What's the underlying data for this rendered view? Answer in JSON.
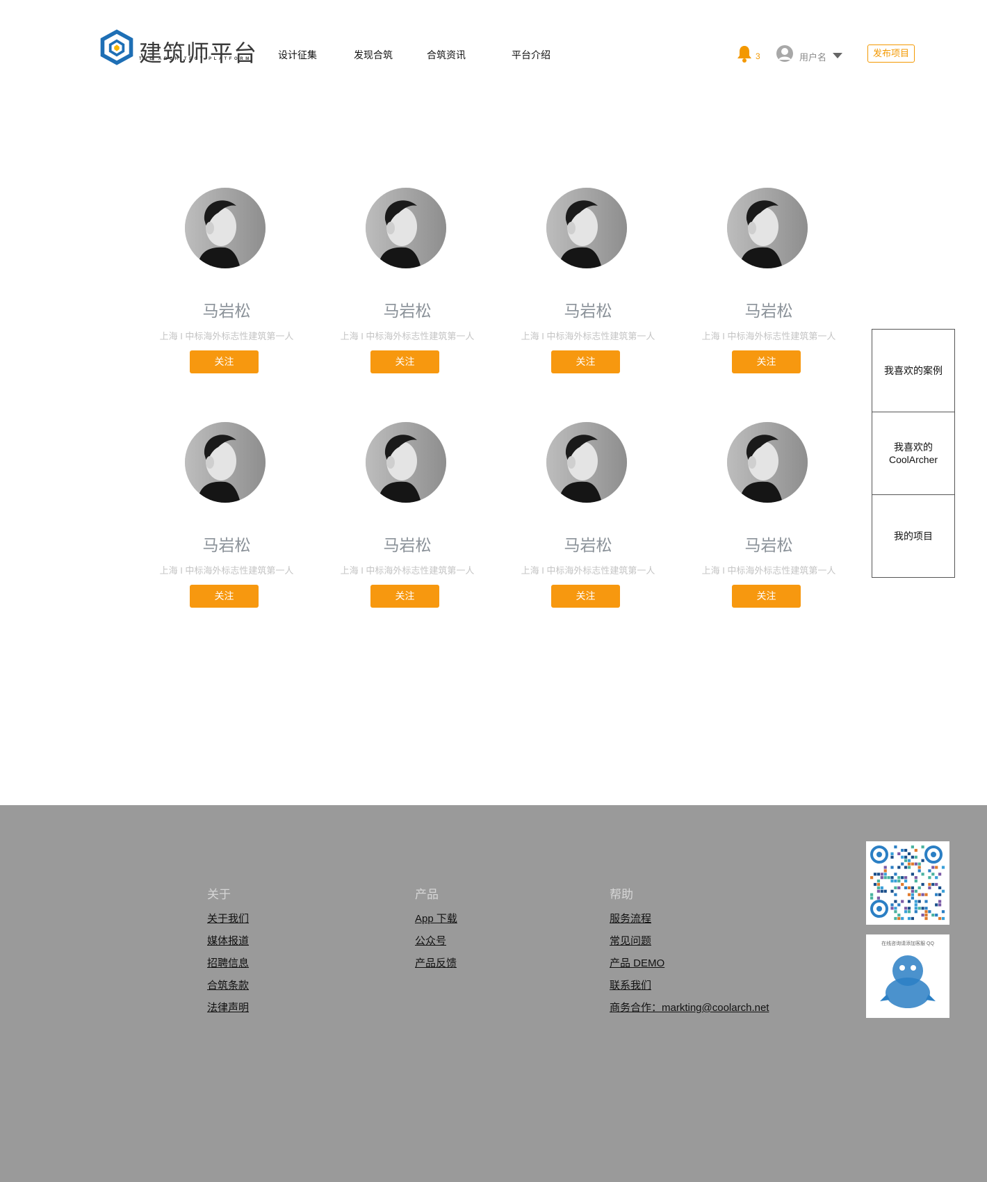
{
  "header": {
    "logo_text": "建筑师平台",
    "logo_sub": "THE ARCHITECT PLATFORM",
    "nav": [
      "设计征集",
      "发现合筑",
      "合筑资讯",
      "平台介绍"
    ],
    "notification_count": "3",
    "username": "用户名",
    "publish_label": "发布项目"
  },
  "cards": [
    {
      "name": "马岩松",
      "desc": "上海 I 中标海外标志性建筑第一人",
      "follow": "关注"
    },
    {
      "name": "马岩松",
      "desc": "上海 I 中标海外标志性建筑第一人",
      "follow": "关注"
    },
    {
      "name": "马岩松",
      "desc": "上海 I 中标海外标志性建筑第一人",
      "follow": "关注"
    },
    {
      "name": "马岩松",
      "desc": "上海 I 中标海外标志性建筑第一人",
      "follow": "关注"
    },
    {
      "name": "马岩松",
      "desc": "上海 I 中标海外标志性建筑第一人",
      "follow": "关注"
    },
    {
      "name": "马岩松",
      "desc": "上海 I 中标海外标志性建筑第一人",
      "follow": "关注"
    },
    {
      "name": "马岩松",
      "desc": "上海 I 中标海外标志性建筑第一人",
      "follow": "关注"
    },
    {
      "name": "马岩松",
      "desc": "上海 I 中标海外标志性建筑第一人",
      "follow": "关注"
    }
  ],
  "side_panel": [
    "我喜欢的案例",
    "我喜欢的\nCoolArcher",
    "我的项目"
  ],
  "footer": {
    "about": {
      "title": "关于",
      "links": [
        "关于我们",
        "媒体报道",
        "招聘信息",
        "合筑条款",
        "法律声明"
      ]
    },
    "product": {
      "title": "产品",
      "links": [
        "App 下载",
        "公众号",
        "产品反馈"
      ]
    },
    "help": {
      "title": "帮助",
      "links": [
        "服务流程",
        "常见问题",
        "产品 DEMO",
        "联系我们",
        "商务合作：markting@coolarch.net"
      ]
    },
    "qq_caption": "在线咨询请添加客服 QQ"
  },
  "colors": {
    "accent": "#f7980f",
    "footer_bg": "#9a9a9a",
    "logo_blue": "#1e6fb5"
  }
}
